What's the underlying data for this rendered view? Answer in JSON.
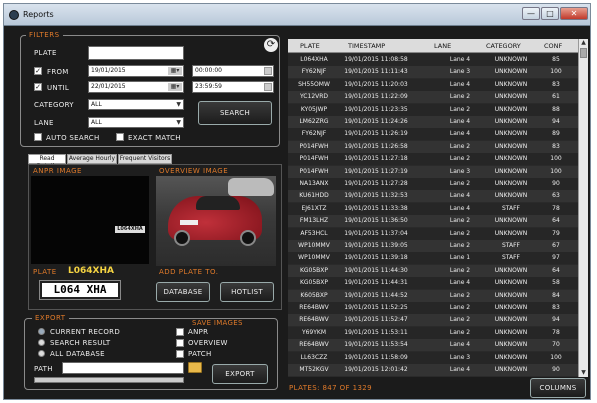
{
  "window": {
    "title": "Reports",
    "minimize": "—",
    "maximize": "□",
    "close": "✕"
  },
  "filters": {
    "legend": "FILTERS",
    "plate_label": "PLATE",
    "plate_value": "",
    "from_label": "FROM",
    "from_date": "19/01/2015",
    "from_time": "00:00:00",
    "until_label": "UNTIL",
    "until_date": "22/01/2015",
    "until_time": "23:59:59",
    "category_label": "CATEGORY",
    "category_value": "ALL",
    "lane_label": "LANE",
    "lane_value": "ALL",
    "search_button": "SEARCH",
    "auto_search_label": "AUTO SEARCH",
    "exact_match_label": "EXACT MATCH",
    "from_checked": "✓",
    "until_checked": "✓"
  },
  "tabs": [
    "Read Details",
    "Average Hourly",
    "Frequent Visitors"
  ],
  "details": {
    "anpr_image_label": "ANPR IMAGE",
    "overview_image_label": "OVERVIEW IMAGE",
    "thumb_plate": "L064XHA",
    "plate_label": "PLATE",
    "plate_value": "L064XHA",
    "plate_large": "L064 XHA",
    "add_plate_label": "ADD PLATE TO.",
    "database_button": "DATABASE",
    "hotlist_button": "HOTLIST"
  },
  "export": {
    "legend": "EXPORT",
    "options": [
      "CURRENT RECORD",
      "SEARCH RESULT",
      "ALL DATABASE"
    ],
    "save_images_label": "SAVE IMAGES",
    "save_options": [
      "ANPR",
      "OVERVIEW",
      "PATCH"
    ],
    "path_label": "PATH",
    "path_value": "",
    "export_button": "EXPORT"
  },
  "table": {
    "headers": [
      "PLATE",
      "TIMESTAMP",
      "LANE",
      "CATEGORY",
      "CONF"
    ],
    "rows": [
      [
        "L064XHA",
        "19/01/2015 11:08:58",
        "Lane 4",
        "UNKNOWN",
        "85"
      ],
      [
        "FY62NJF",
        "19/01/2015 11:11:43",
        "Lane 3",
        "UNKNOWN",
        "100"
      ],
      [
        "SH55OMW",
        "19/01/2015 11:20:03",
        "Lane 4",
        "UNKNOWN",
        "83"
      ],
      [
        "YC12VRD",
        "19/01/2015 11:22:09",
        "Lane 2",
        "UNKNOWN",
        "61"
      ],
      [
        "KY05JWP",
        "19/01/2015 11:23:35",
        "Lane 2",
        "UNKNOWN",
        "88"
      ],
      [
        "LM62ZRG",
        "19/01/2015 11:24:26",
        "Lane 4",
        "UNKNOWN",
        "94"
      ],
      [
        "FY62NJF",
        "19/01/2015 11:26:19",
        "Lane 4",
        "UNKNOWN",
        "89"
      ],
      [
        "P014FWH",
        "19/01/2015 11:26:58",
        "Lane 2",
        "UNKNOWN",
        "83"
      ],
      [
        "P014FWH",
        "19/01/2015 11:27:18",
        "Lane 2",
        "UNKNOWN",
        "100"
      ],
      [
        "P014FWH",
        "19/01/2015 11:27:19",
        "Lane 3",
        "UNKNOWN",
        "100"
      ],
      [
        "NA13ANX",
        "19/01/2015 11:27:28",
        "Lane 2",
        "UNKNOWN",
        "90"
      ],
      [
        "KU61HDD",
        "19/01/2015 11:32:53",
        "Lane 4",
        "UNKNOWN",
        "63"
      ],
      [
        "EJ61XTZ",
        "19/01/2015 11:33:38",
        "Lane 4",
        "STAFF",
        "78"
      ],
      [
        "FM13LHZ",
        "19/01/2015 11:36:50",
        "Lane 2",
        "UNKNOWN",
        "64"
      ],
      [
        "AF53HCL",
        "19/01/2015 11:37:04",
        "Lane 2",
        "UNKNOWN",
        "79"
      ],
      [
        "WP10MMV",
        "19/01/2015 11:39:05",
        "Lane 2",
        "STAFF",
        "67"
      ],
      [
        "WP10MMV",
        "19/01/2015 11:39:18",
        "Lane 1",
        "STAFF",
        "97"
      ],
      [
        "KG05BXP",
        "19/01/2015 11:44:30",
        "Lane 2",
        "UNKNOWN",
        "64"
      ],
      [
        "KG05BXP",
        "19/01/2015 11:44:31",
        "Lane 4",
        "UNKNOWN",
        "58"
      ],
      [
        "K605BXP",
        "19/01/2015 11:44:52",
        "Lane 2",
        "UNKNOWN",
        "84"
      ],
      [
        "RE64BWV",
        "19/01/2015 11:52:25",
        "Lane 2",
        "UNKNOWN",
        "83"
      ],
      [
        "RE64BWV",
        "19/01/2015 11:52:47",
        "Lane 2",
        "UNKNOWN",
        "94"
      ],
      [
        "Y69YKM",
        "19/01/2015 11:53:11",
        "Lane 2",
        "UNKNOWN",
        "78"
      ],
      [
        "RE64BWV",
        "19/01/2015 11:53:54",
        "Lane 4",
        "UNKNOWN",
        "70"
      ],
      [
        "LL63CZZ",
        "19/01/2015 11:58:09",
        "Lane 3",
        "UNKNOWN",
        "100"
      ],
      [
        "MT52KGV",
        "19/01/2015 12:01:42",
        "Lane 4",
        "UNKNOWN",
        "90"
      ]
    ]
  },
  "footer": {
    "plates_count": "PLATES: 847 OF 1329",
    "columns_button": "COLUMNS"
  },
  "colors": {
    "accent": "#e07a2a",
    "plate_yellow": "#f5d442",
    "background": "#1b1b1b",
    "row_dark": "#2a2a2a",
    "row_alt": "#333333"
  }
}
